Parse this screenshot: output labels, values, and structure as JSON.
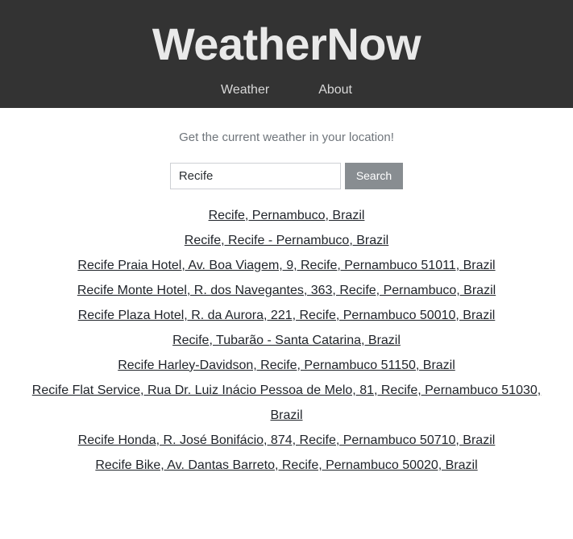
{
  "header": {
    "brand_title": "WeatherNow",
    "nav": [
      {
        "label": "Weather"
      },
      {
        "label": "About"
      }
    ]
  },
  "main": {
    "lead_text": "Get the current weather in your location!",
    "search": {
      "value": "Recife",
      "placeholder": "",
      "button_label": "Search"
    },
    "results": [
      {
        "label": "Recife, Pernambuco, Brazil"
      },
      {
        "label": "Recife, Recife - Pernambuco, Brazil"
      },
      {
        "label": "Recife Praia Hotel, Av. Boa Viagem, 9, Recife, Pernambuco 51011, Brazil"
      },
      {
        "label": "Recife Monte Hotel, R. dos Navegantes, 363, Recife, Pernambuco, Brazil"
      },
      {
        "label": "Recife Plaza Hotel, R. da Aurora, 221, Recife, Pernambuco 50010, Brazil"
      },
      {
        "label": "Recife, Tubarão - Santa Catarina, Brazil"
      },
      {
        "label": "Recife Harley-Davidson, Recife, Pernambuco 51150, Brazil"
      },
      {
        "label": "Recife Flat Service, Rua Dr. Luiz Inácio Pessoa de Melo, 81, Recife, Pernambuco 51030, Brazil"
      },
      {
        "label": "Recife Honda, R. José Bonifácio, 874, Recife, Pernambuco 50710, Brazil"
      },
      {
        "label": "Recife Bike, Av. Dantas Barreto, Recife, Pernambuco 50020, Brazil"
      }
    ]
  },
  "colors": {
    "header_background": "#333333",
    "brand_text": "#e9e9e9",
    "nav_text": "#d8d8d8",
    "page_background": "#ffffff",
    "lead_text": "#6f757b",
    "link_text": "#1f2329",
    "button_background": "#888d91",
    "button_text": "#ffffff",
    "input_border": "#ced0d4"
  }
}
